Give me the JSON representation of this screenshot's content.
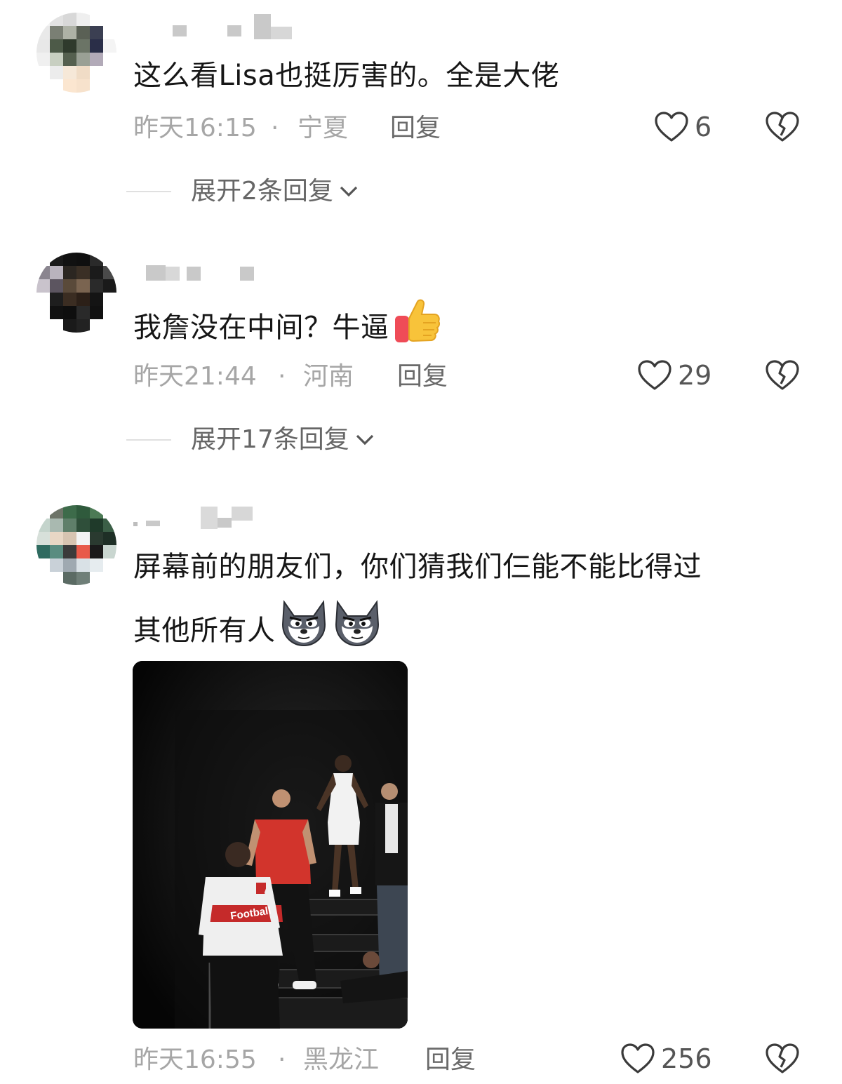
{
  "comments": [
    {
      "text": "这么看Lisa也挺厉害的。全是大佬",
      "time": "昨天16:15",
      "separator": "·",
      "region": "宁夏",
      "reply_label": "回复",
      "likes": "6",
      "expand_label": "展开2条回复"
    },
    {
      "text": "我詹没在中间？牛逼",
      "emoji": "thumbs-up-icon",
      "time": "昨天21:44",
      "separator": "·",
      "region": "河南",
      "reply_label": "回复",
      "likes": "29",
      "expand_label": "展开17条回复"
    },
    {
      "text_line1": "屏幕前的朋友们，你们猜我们仨能不能比得过",
      "text_line2": "其他所有人",
      "emoji": "husky-dog-face-icon",
      "image": {
        "shirt_text": "Football"
      },
      "time": "昨天16:55",
      "separator": "·",
      "region": "黑龙江",
      "reply_label": "回复",
      "likes": "256"
    }
  ],
  "colors": {
    "text": "#161616",
    "meta": "#a6a6a6",
    "reply": "#6a6a6a",
    "icon_stroke": "#3a3a3a"
  }
}
